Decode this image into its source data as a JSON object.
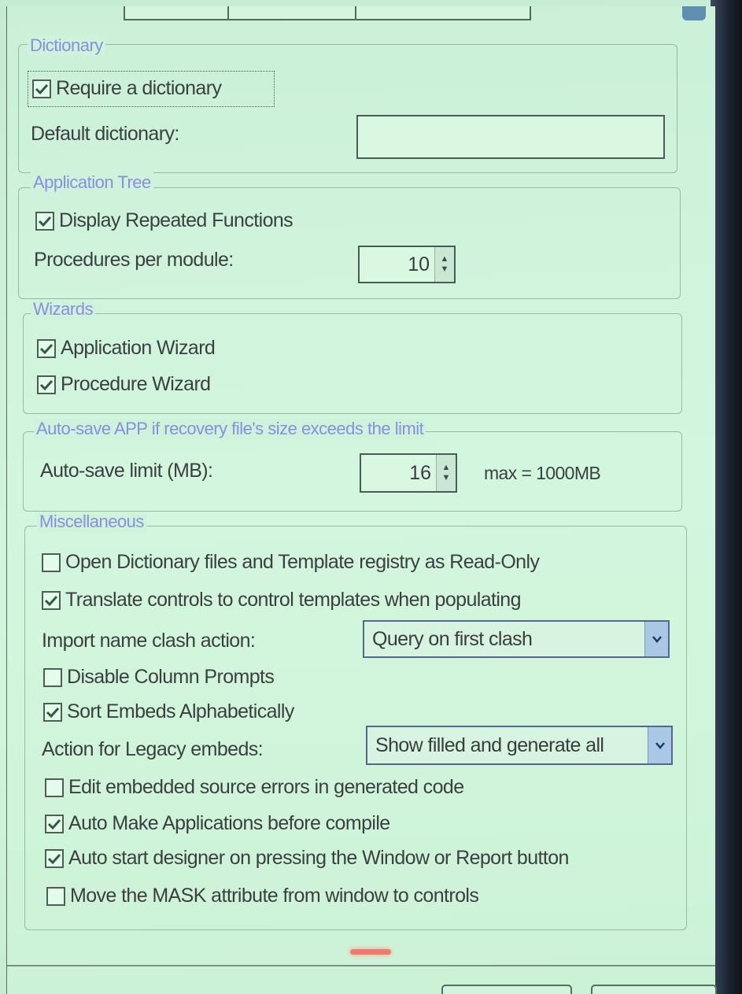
{
  "dictionary": {
    "legend": "Dictionary",
    "require_dictionary": {
      "label": "Require a dictionary",
      "checked": true
    },
    "default_dictionary": {
      "label": "Default dictionary:",
      "value": ""
    }
  },
  "application_tree": {
    "legend": "Application Tree",
    "display_repeated_functions": {
      "label": "Display Repeated Functions",
      "checked": true
    },
    "procedures_per_module": {
      "label": "Procedures per module:",
      "value": "10"
    }
  },
  "wizards": {
    "legend": "Wizards",
    "application_wizard": {
      "label": "Application Wizard",
      "checked": true
    },
    "procedure_wizard": {
      "label": "Procedure Wizard",
      "checked": true
    }
  },
  "autosave": {
    "legend": "Auto-save APP if recovery file's size exceeds the limit",
    "limit": {
      "label": "Auto-save limit (MB):",
      "value": "16",
      "max_text": "max = 1000MB"
    }
  },
  "misc": {
    "legend": "Miscellaneous",
    "open_readonly": {
      "label": "Open Dictionary files and Template registry as Read-Only",
      "checked": false
    },
    "translate_controls": {
      "label": "Translate controls to control templates when populating",
      "checked": true
    },
    "import_clash": {
      "label": "Import name clash action:",
      "value": "Query on first clash"
    },
    "disable_column_prompts": {
      "label": "Disable Column Prompts",
      "checked": false
    },
    "sort_embeds": {
      "label": "Sort Embeds Alphabetically",
      "checked": true
    },
    "legacy_embeds": {
      "label": "Action for Legacy embeds:",
      "value": "Show filled and generate all"
    },
    "edit_embedded_errors": {
      "label": "Edit embedded source errors in generated code",
      "checked": false
    },
    "auto_make": {
      "label": "Auto Make Applications before compile",
      "checked": true
    },
    "auto_start_designer": {
      "label": "Auto start designer on pressing the Window or Report button",
      "checked": true
    },
    "move_mask": {
      "label": "Move the MASK attribute from window to controls",
      "checked": false
    }
  },
  "icons": {
    "check": "checkmark-icon",
    "spin": "spin-arrows-icon",
    "dropdown": "chevron-down-icon"
  }
}
